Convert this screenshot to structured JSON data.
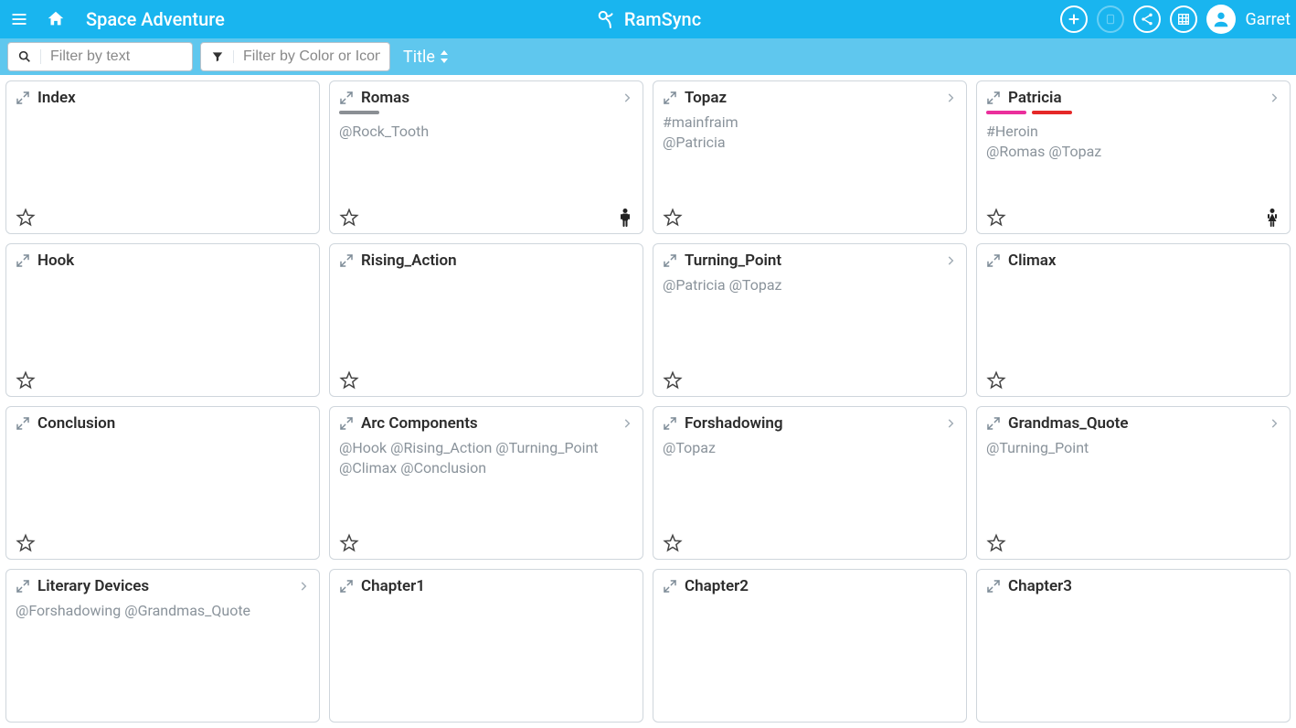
{
  "header": {
    "page_title": "Space Adventure",
    "brand": "RamSync",
    "username": "Garret"
  },
  "filterbar": {
    "text_placeholder": "Filter by text",
    "color_placeholder": "Filter by Color or Icon",
    "sort_label": "Title"
  },
  "cards": [
    {
      "title": "Index",
      "body_lines": [],
      "has_chevron": false,
      "strips": [],
      "char_icon": null
    },
    {
      "title": "Romas",
      "body_lines": [
        "@Rock_Tooth"
      ],
      "has_chevron": true,
      "strips": [
        "#8b8f94"
      ],
      "char_icon": "male"
    },
    {
      "title": "Topaz",
      "body_lines": [
        "#mainfraim",
        "@Patricia"
      ],
      "has_chevron": true,
      "strips": [],
      "char_icon": null
    },
    {
      "title": "Patricia",
      "body_lines": [
        "#Heroin",
        "@Romas @Topaz"
      ],
      "has_chevron": true,
      "strips": [
        "#ea2f9c",
        "#e52828"
      ],
      "char_icon": "female"
    },
    {
      "title": "Hook",
      "body_lines": [],
      "has_chevron": false,
      "strips": [],
      "char_icon": null
    },
    {
      "title": "Rising_Action",
      "body_lines": [],
      "has_chevron": false,
      "strips": [],
      "char_icon": null
    },
    {
      "title": "Turning_Point",
      "body_lines": [
        "@Patricia @Topaz"
      ],
      "has_chevron": true,
      "strips": [],
      "char_icon": null
    },
    {
      "title": "Climax",
      "body_lines": [],
      "has_chevron": false,
      "strips": [],
      "char_icon": null
    },
    {
      "title": "Conclusion",
      "body_lines": [],
      "has_chevron": false,
      "strips": [],
      "char_icon": null
    },
    {
      "title": "Arc Components",
      "body_lines": [
        "@Hook @Rising_Action @Turning_Point @Climax @Conclusion"
      ],
      "has_chevron": true,
      "strips": [],
      "char_icon": null
    },
    {
      "title": "Forshadowing",
      "body_lines": [
        "@Topaz"
      ],
      "has_chevron": true,
      "strips": [],
      "char_icon": null
    },
    {
      "title": "Grandmas_Quote",
      "body_lines": [
        "@Turning_Point"
      ],
      "has_chevron": true,
      "strips": [],
      "char_icon": null
    },
    {
      "title": "Literary Devices",
      "body_lines": [
        "@Forshadowing @Grandmas_Quote"
      ],
      "has_chevron": true,
      "strips": [],
      "char_icon": null,
      "row4": true,
      "hide_footer": true
    },
    {
      "title": "Chapter1",
      "body_lines": [],
      "has_chevron": false,
      "strips": [],
      "char_icon": null,
      "row4": true,
      "hide_footer": true
    },
    {
      "title": "Chapter2",
      "body_lines": [],
      "has_chevron": false,
      "strips": [],
      "char_icon": null,
      "row4": true,
      "hide_footer": true
    },
    {
      "title": "Chapter3",
      "body_lines": [],
      "has_chevron": false,
      "strips": [],
      "char_icon": null,
      "row4": true,
      "hide_footer": true
    }
  ]
}
